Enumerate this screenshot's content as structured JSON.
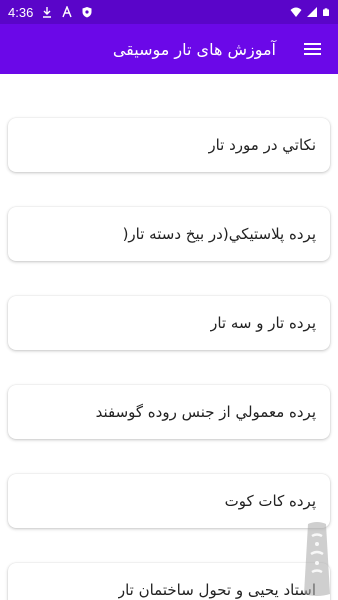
{
  "status_bar": {
    "time": "4:36",
    "left_icons": [
      "download-icon",
      "a-icon",
      "shield-icon"
    ],
    "right_icons": [
      "wifi-icon",
      "signal-icon",
      "battery-icon"
    ]
  },
  "app_bar": {
    "title": "آموزش های تار موسیقی",
    "menu_icon": "hamburger-menu-icon"
  },
  "items": [
    {
      "label": "نكاتي در مورد تار"
    },
    {
      "label": "پرده پلاستيكي(در بيخ دسته تار("
    },
    {
      "label": "پرده تار و سه تار"
    },
    {
      "label": "پرده معمولي از جنس روده گوسفند"
    },
    {
      "label": "پرده كات كوت"
    },
    {
      "label": "استاد يحيى و تحول ساختمان تار"
    }
  ],
  "colors": {
    "status_bar": "#5a05c9",
    "app_bar": "#6b08e8",
    "card_bg": "#ffffff",
    "text": "#222222"
  }
}
